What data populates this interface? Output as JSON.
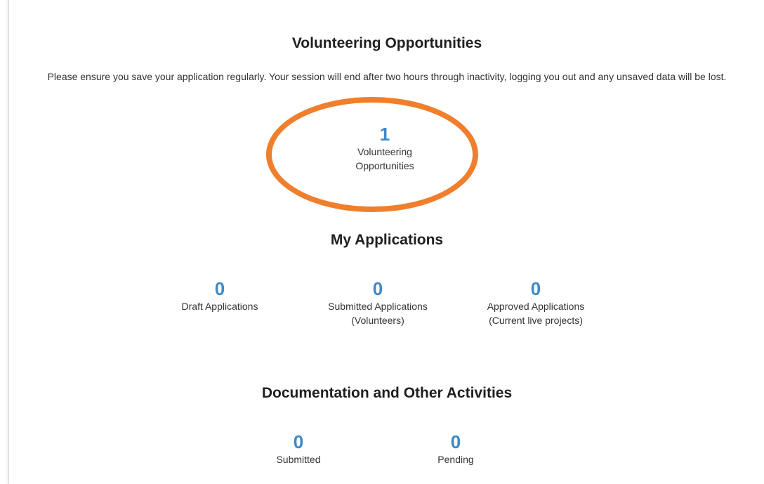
{
  "volunteering": {
    "title": "Volunteering Opportunities",
    "notice": "Please ensure you save your application regularly. Your session will end after two hours through inactivity, logging you out and any unsaved data will be lost.",
    "stat": {
      "count": "1",
      "label_line1": "Volunteering",
      "label_line2": "Opportunities"
    }
  },
  "my_applications": {
    "title": "My Applications",
    "stats": [
      {
        "count": "0",
        "label_line1": "Draft Applications",
        "label_line2": ""
      },
      {
        "count": "0",
        "label_line1": "Submitted Applications",
        "label_line2": "(Volunteers)"
      },
      {
        "count": "0",
        "label_line1": "Approved Applications",
        "label_line2": "(Current live projects)"
      }
    ]
  },
  "documentation": {
    "title": "Documentation and Other Activities",
    "stats": [
      {
        "count": "0",
        "label": "Submitted"
      },
      {
        "count": "0",
        "label": "Pending"
      }
    ]
  },
  "colors": {
    "accent_number": "#3f88c5",
    "highlight_ring": "#ef7f2c"
  }
}
